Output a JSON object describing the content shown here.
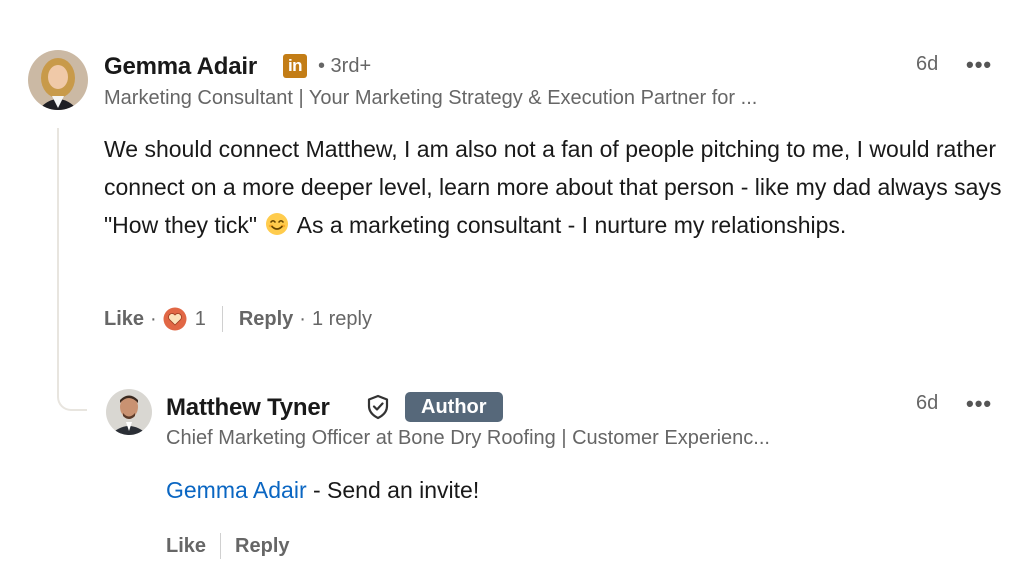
{
  "comment": {
    "author_name": "Gemma Adair",
    "linkedin_badge": "in",
    "degree": "• 3rd+",
    "headline": "Marketing Consultant | Your Marketing Strategy & Execution Partner for ...",
    "timestamp": "6d",
    "more_label": "•••",
    "text_before_emoji": "We should connect Matthew, I am also not a fan of people pitching to me, I would rather connect on a more deeper level, learn more about that person - like my dad always says \"How they tick\"",
    "text_after_emoji": "As a marketing consultant - I nurture my relationships.",
    "emoji_icon": "smiling-face-emoji",
    "like_label": "Like",
    "reaction_icon": "love-heart-reaction-icon",
    "reaction_count": "1",
    "reply_label": "Reply",
    "reply_count": "1 reply"
  },
  "reply": {
    "author_name": "Matthew Tyner",
    "verified_icon": "shield-check-icon",
    "author_badge": "Author",
    "headline": "Chief Marketing Officer at Bone Dry Roofing | Customer Experienc...",
    "timestamp": "6d",
    "more_label": "•••",
    "mention": "Gemma Adair",
    "text": " - Send an invite!",
    "like_label": "Like",
    "reply_label": "Reply"
  },
  "colors": {
    "link_blue": "#0a66c2",
    "author_badge_bg": "#56687a",
    "linkedin_badge_bg": "#c37d16",
    "reaction_orange": "#e16745",
    "muted_text": "#666666"
  }
}
